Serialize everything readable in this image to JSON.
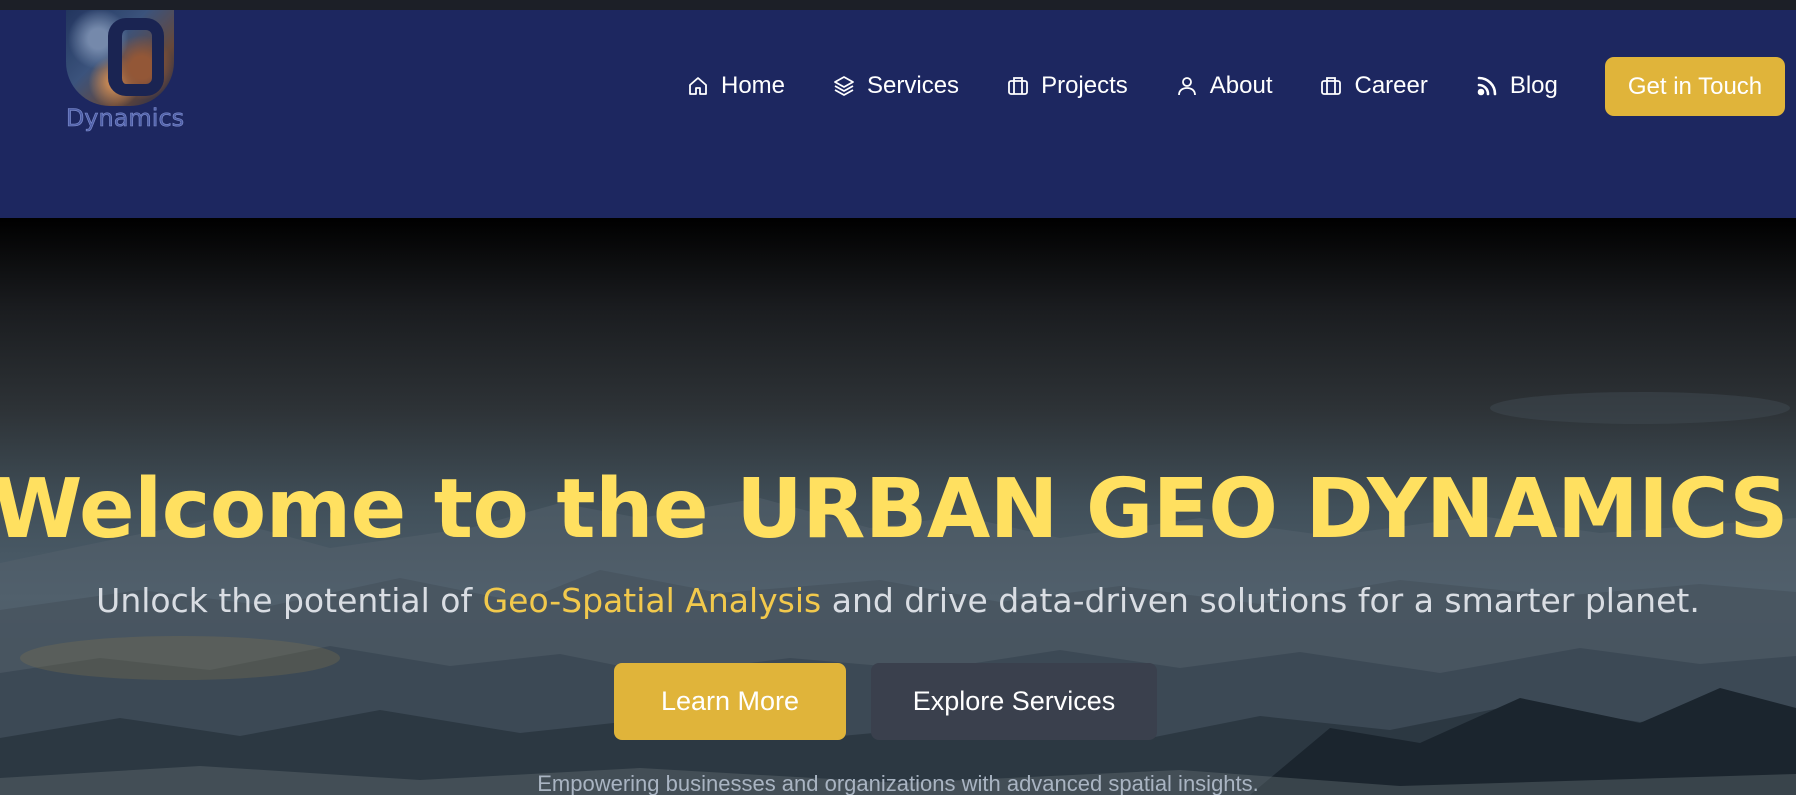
{
  "brand": {
    "logo_text": "Dynamics",
    "logo_icon": "ugd-globe-logo"
  },
  "nav": {
    "items": [
      {
        "label": "Home",
        "icon": "home-icon"
      },
      {
        "label": "Services",
        "icon": "layers-icon"
      },
      {
        "label": "Projects",
        "icon": "briefcase-icon"
      },
      {
        "label": "About",
        "icon": "user-icon"
      },
      {
        "label": "Career",
        "icon": "briefcase-icon"
      },
      {
        "label": "Blog",
        "icon": "rss-icon"
      }
    ],
    "cta_label": "Get in Touch"
  },
  "hero": {
    "title": "Welcome to the URBAN GEO DYNAMICS",
    "subtitle_prefix": "Unlock the potential of ",
    "subtitle_highlight": "Geo-Spatial Analysis",
    "subtitle_suffix": " and drive data-driven solutions for a smarter planet.",
    "primary_button": "Learn More",
    "secondary_button": "Explore Services",
    "tagline": "Empowering businesses and organizations with advanced spatial insights."
  },
  "colors": {
    "header_bg": "#1d2760",
    "accent": "#e0b43a",
    "title": "#ffe060",
    "highlight": "#f2c94c",
    "secondary_button": "#3a404d"
  }
}
